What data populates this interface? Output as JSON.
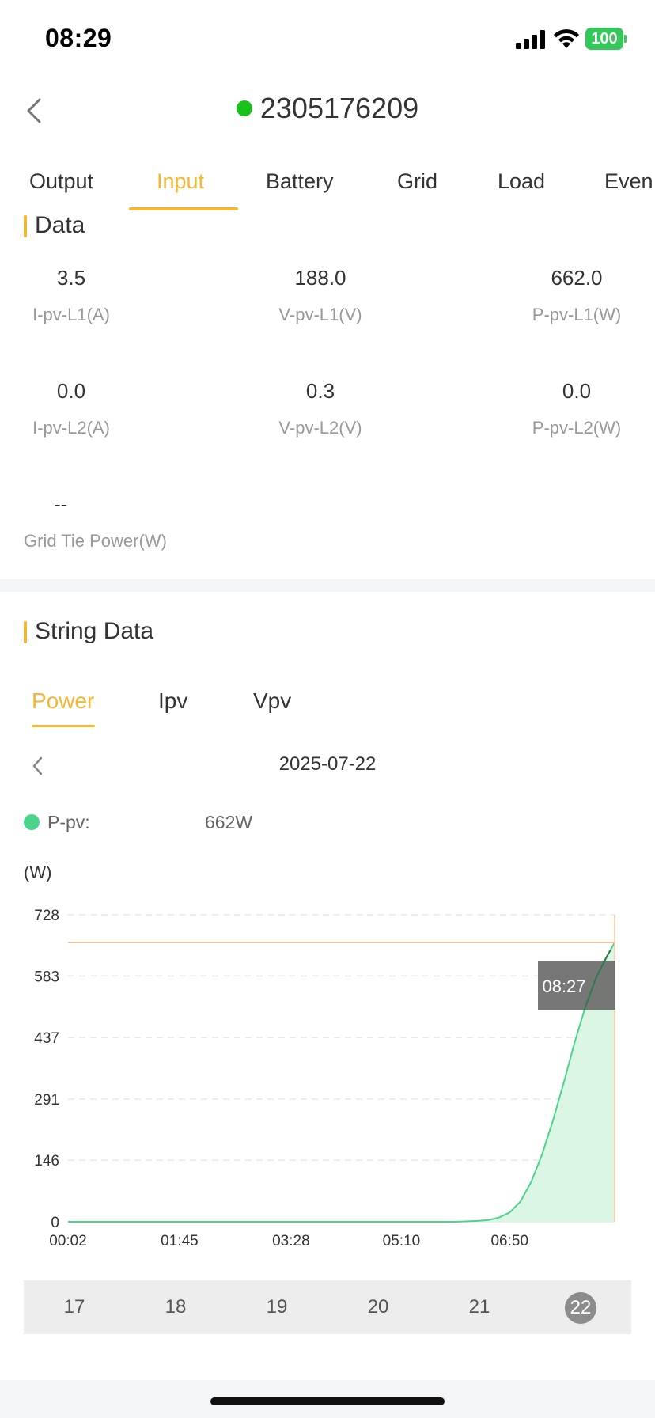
{
  "status_bar": {
    "time": "08:29",
    "battery": "100"
  },
  "header": {
    "device_id": "2305176209",
    "online_color": "#18c219"
  },
  "tabs": [
    {
      "label": "Output",
      "active": false
    },
    {
      "label": "Input",
      "active": true
    },
    {
      "label": "Battery",
      "active": false
    },
    {
      "label": "Grid",
      "active": false
    },
    {
      "label": "Load",
      "active": false
    },
    {
      "label": "Even",
      "active": false
    }
  ],
  "data_section": {
    "title": "Data",
    "metrics": [
      {
        "value": "3.5",
        "label": "I-pv-L1(A)"
      },
      {
        "value": "188.0",
        "label": "V-pv-L1(V)"
      },
      {
        "value": "662.0",
        "label": "P-pv-L1(W)"
      },
      {
        "value": "0.0",
        "label": "I-pv-L2(A)"
      },
      {
        "value": "0.3",
        "label": "V-pv-L2(V)"
      },
      {
        "value": "0.0",
        "label": "P-pv-L2(W)"
      },
      {
        "value": "--",
        "label": "Grid Tie Power(W)"
      }
    ]
  },
  "string_section": {
    "title": "String Data",
    "subtabs": [
      {
        "label": "Power",
        "active": true
      },
      {
        "label": "Ipv",
        "active": false
      },
      {
        "label": "Vpv",
        "active": false
      }
    ],
    "date": "2025-07-22",
    "legend": {
      "label": "P-pv:",
      "value": "662W",
      "color": "#4cd48a"
    },
    "unit": "(W)"
  },
  "chart_data": {
    "type": "area",
    "ylabel": "(W)",
    "y_ticks": [
      "0",
      "146",
      "291",
      "437",
      "583",
      "728"
    ],
    "ylim": [
      0,
      728
    ],
    "x_ticks": [
      "00:02",
      "01:45",
      "03:28",
      "05:10",
      "06:50"
    ],
    "x_axis_minutes": [
      2,
      507
    ],
    "series": [
      {
        "name": "P-pv",
        "color": "#4cd48a",
        "points": [
          [
            "00:02",
            0
          ],
          [
            "06:00",
            0
          ],
          [
            "06:20",
            2
          ],
          [
            "06:30",
            4
          ],
          [
            "06:40",
            10
          ],
          [
            "06:50",
            22
          ],
          [
            "07:00",
            48
          ],
          [
            "07:10",
            95
          ],
          [
            "07:20",
            160
          ],
          [
            "07:30",
            240
          ],
          [
            "07:40",
            330
          ],
          [
            "07:50",
            425
          ],
          [
            "08:00",
            510
          ],
          [
            "08:10",
            580
          ],
          [
            "08:20",
            630
          ],
          [
            "08:27",
            662
          ]
        ]
      }
    ],
    "tooltip": {
      "label": "08:27",
      "value": 662
    },
    "grid": true
  },
  "day_selector": {
    "days": [
      "17",
      "18",
      "19",
      "20",
      "21",
      "22"
    ],
    "selected": "22"
  }
}
